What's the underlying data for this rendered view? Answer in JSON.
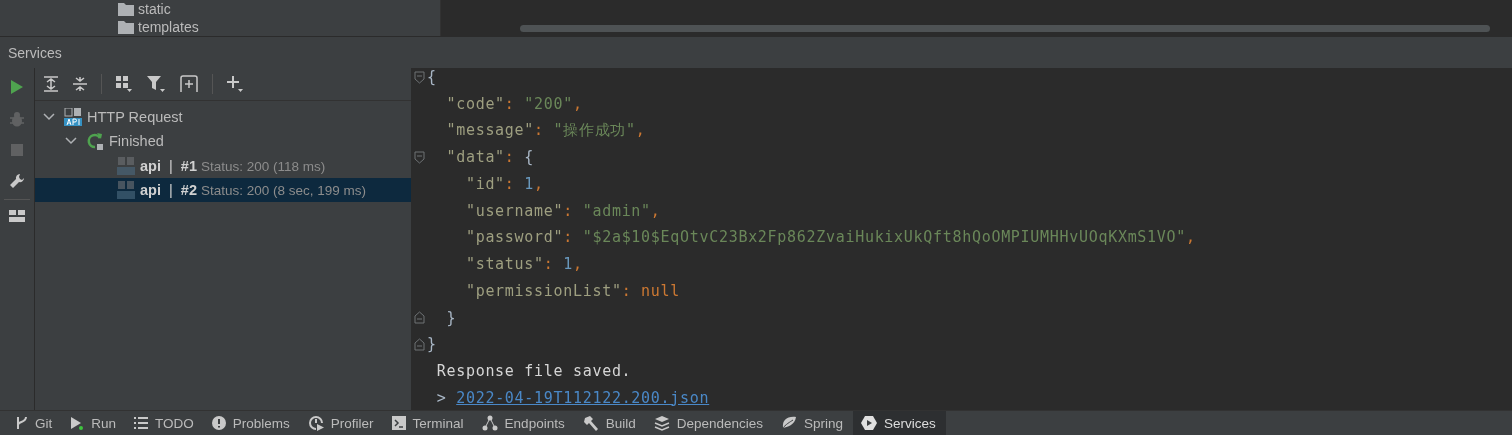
{
  "project_tree": {
    "items": [
      {
        "label": "static"
      },
      {
        "label": "templates"
      }
    ]
  },
  "services": {
    "title": "Services",
    "side_toolbar": [
      {
        "kind": "run",
        "disabled": false
      },
      {
        "kind": "debug",
        "disabled": true
      },
      {
        "kind": "stop",
        "disabled": true
      },
      {
        "kind": "settings",
        "disabled": false
      },
      {
        "kind": "layout",
        "disabled": false
      }
    ],
    "toolbar": [
      {
        "kind": "expand-all"
      },
      {
        "kind": "collapse-all"
      },
      {
        "kind": "separator"
      },
      {
        "kind": "group"
      },
      {
        "kind": "filter"
      },
      {
        "kind": "add-pane"
      },
      {
        "kind": "separator"
      },
      {
        "kind": "add"
      }
    ],
    "tree": [
      {
        "kind": "http",
        "label": "HTTP Request",
        "expanded": true,
        "children": [
          {
            "kind": "finished",
            "label": "Finished",
            "expanded": true,
            "children": [
              {
                "kind": "request",
                "name": "api",
                "separator": "|",
                "number": "#1",
                "status": "Status: 200 (118 ms)",
                "selected": false
              },
              {
                "kind": "request",
                "name": "api",
                "separator": "|",
                "number": "#2",
                "status": "Status: 200 (8 sec, 199 ms)",
                "selected": true
              }
            ]
          }
        ]
      }
    ]
  },
  "response": {
    "lines": [
      {
        "fold_start": true,
        "tokens": [
          {
            "kind": "brace",
            "text": "{"
          }
        ]
      },
      {
        "tokens": [
          {
            "kind": "key",
            "text": "  \"code\""
          },
          {
            "kind": "punct",
            "text": ": "
          },
          {
            "kind": "string",
            "text": "\"200\""
          },
          {
            "kind": "punct",
            "text": ","
          }
        ]
      },
      {
        "tokens": [
          {
            "kind": "key",
            "text": "  \"message\""
          },
          {
            "kind": "punct",
            "text": ": "
          },
          {
            "kind": "string",
            "text": "\"操作成功\""
          },
          {
            "kind": "punct",
            "text": ","
          }
        ]
      },
      {
        "fold_start": true,
        "tokens": [
          {
            "kind": "key",
            "text": "  \"data\""
          },
          {
            "kind": "punct",
            "text": ": "
          },
          {
            "kind": "brace",
            "text": "{"
          }
        ]
      },
      {
        "tokens": [
          {
            "kind": "key",
            "text": "    \"id\""
          },
          {
            "kind": "punct",
            "text": ": "
          },
          {
            "kind": "number",
            "text": "1"
          },
          {
            "kind": "punct",
            "text": ","
          }
        ]
      },
      {
        "tokens": [
          {
            "kind": "key",
            "text": "    \"username\""
          },
          {
            "kind": "punct",
            "text": ": "
          },
          {
            "kind": "string",
            "text": "\"admin\""
          },
          {
            "kind": "punct",
            "text": ","
          }
        ]
      },
      {
        "tokens": [
          {
            "kind": "key",
            "text": "    \"password\""
          },
          {
            "kind": "punct",
            "text": ": "
          },
          {
            "kind": "string",
            "text": "\"$2a$10$EqOtvC23Bx2Fp862ZvaiHukixUkQft8hQoOMPIUMHHvUOqKXmS1VO\""
          },
          {
            "kind": "punct",
            "text": ","
          }
        ]
      },
      {
        "tokens": [
          {
            "kind": "key",
            "text": "    \"status\""
          },
          {
            "kind": "punct",
            "text": ": "
          },
          {
            "kind": "number",
            "text": "1"
          },
          {
            "kind": "punct",
            "text": ","
          }
        ]
      },
      {
        "tokens": [
          {
            "kind": "key",
            "text": "    \"permissionList\""
          },
          {
            "kind": "punct",
            "text": ": "
          },
          {
            "kind": "keyword",
            "text": "null"
          }
        ]
      },
      {
        "fold_end": true,
        "tokens": [
          {
            "kind": "brace",
            "text": "  }"
          }
        ]
      },
      {
        "fold_end": true,
        "tokens": [
          {
            "kind": "brace",
            "text": "}"
          }
        ]
      }
    ],
    "output": [
      {
        "kind": "message",
        "text": "Response file saved."
      },
      {
        "kind": "link",
        "prefix": ">",
        "text": "2022-04-19T112122.200.json"
      }
    ]
  },
  "tool_windows": [
    {
      "kind": "git",
      "label": "Git",
      "selected": false
    },
    {
      "kind": "run",
      "label": "Run",
      "selected": false
    },
    {
      "kind": "todo",
      "label": "TODO",
      "selected": false
    },
    {
      "kind": "problems",
      "label": "Problems",
      "selected": false
    },
    {
      "kind": "profiler",
      "label": "Profiler",
      "selected": false
    },
    {
      "kind": "terminal",
      "label": "Terminal",
      "selected": false
    },
    {
      "kind": "endpoints",
      "label": "Endpoints",
      "selected": false
    },
    {
      "kind": "build",
      "label": "Build",
      "selected": false
    },
    {
      "kind": "dependencies",
      "label": "Dependencies",
      "selected": false
    },
    {
      "kind": "spring",
      "label": "Spring",
      "selected": false
    },
    {
      "kind": "services",
      "label": "Services",
      "selected": true
    }
  ]
}
